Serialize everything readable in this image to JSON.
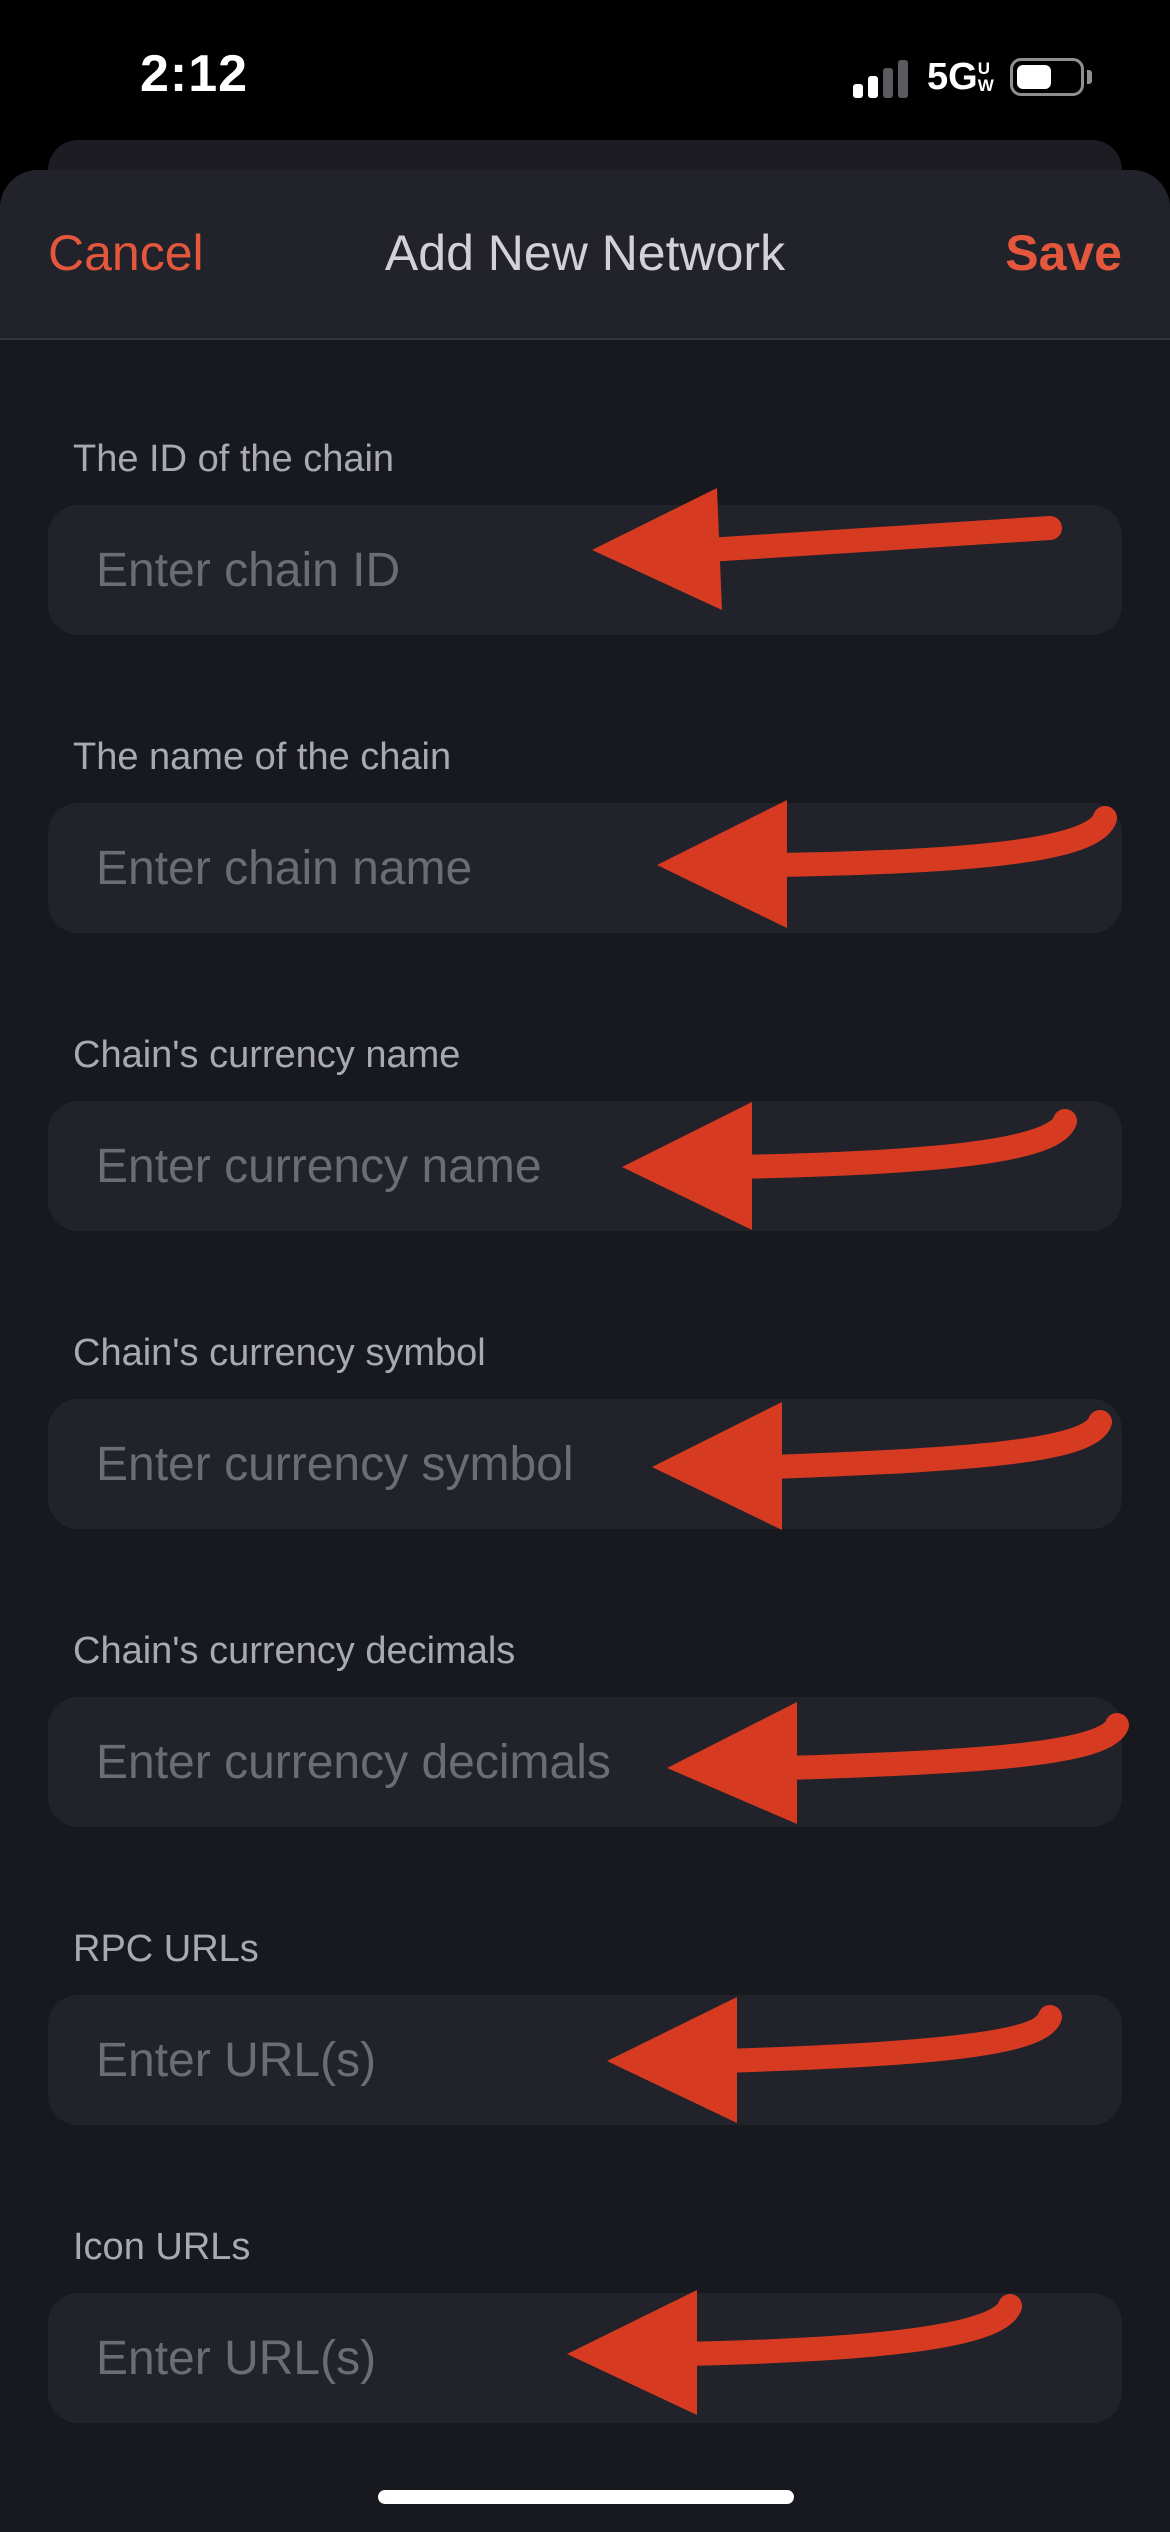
{
  "status_bar": {
    "time": "2:12",
    "network": "5G",
    "network_superscript": "UW",
    "signal_bars": 2,
    "signal_bars_total": 4,
    "battery_level": 0.55
  },
  "header": {
    "cancel_label": "Cancel",
    "title": "Add New Network",
    "save_label": "Save"
  },
  "fields": [
    {
      "label": "The ID of the chain",
      "placeholder": "Enter chain ID",
      "value": ""
    },
    {
      "label": "The name of the chain",
      "placeholder": "Enter chain name",
      "value": ""
    },
    {
      "label": "Chain's currency name",
      "placeholder": "Enter currency name",
      "value": ""
    },
    {
      "label": "Chain's currency symbol",
      "placeholder": "Enter currency symbol",
      "value": ""
    },
    {
      "label": "Chain's currency decimals",
      "placeholder": "Enter currency decimals",
      "value": ""
    },
    {
      "label": "RPC URLs",
      "placeholder": "Enter URL(s)",
      "value": ""
    },
    {
      "label": "Icon URLs",
      "placeholder": "Enter URL(s)",
      "value": ""
    }
  ],
  "colors": {
    "accent": "#e4573d",
    "annotation_arrow": "#d63b22",
    "background": "#18181f",
    "field_background": "#22222a",
    "label": "#a9a9b1",
    "placeholder": "#6c6c74"
  }
}
